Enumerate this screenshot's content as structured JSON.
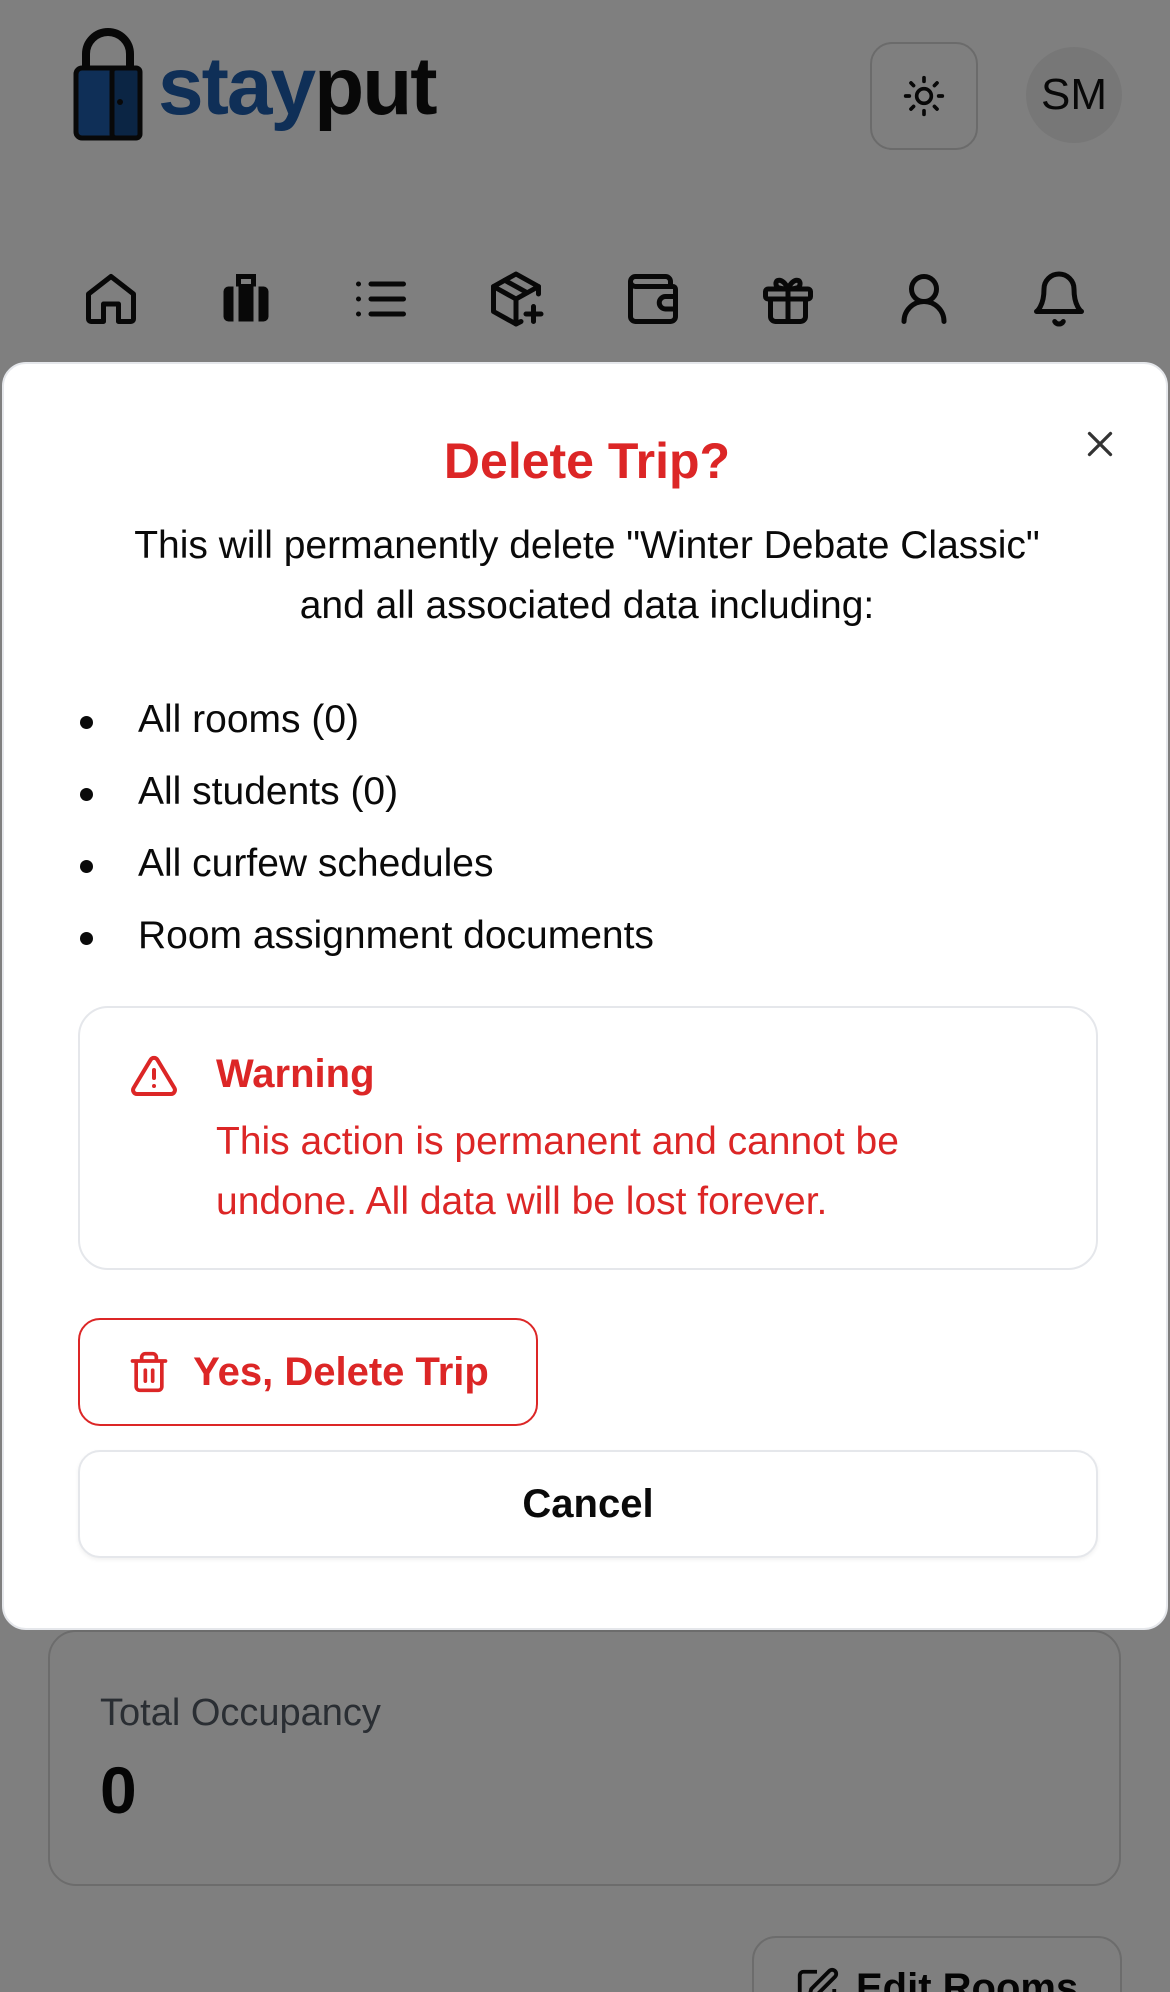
{
  "app": {
    "logo": {
      "part1": "stay",
      "part2": "put"
    },
    "avatar_initials": "SM",
    "theme_icon": "sun-icon",
    "nav_icons": [
      "home-icon",
      "luggage-icon",
      "list-icon",
      "package-plus-icon",
      "wallet-icon",
      "gift-icon",
      "user-icon",
      "bell-icon"
    ]
  },
  "background": {
    "card": {
      "label": "Total Occupancy",
      "value": "0"
    },
    "edit_button": {
      "label": "Edit Rooms"
    }
  },
  "modal": {
    "title": "Delete Trip?",
    "description": "This will permanently delete \"Winter Debate Classic\" and all associated data including:",
    "items": [
      "All rooms (0)",
      "All students (0)",
      "All curfew schedules",
      "Room assignment documents"
    ],
    "warning": {
      "title": "Warning",
      "text": "This action is permanent and cannot be undone. All data will be lost forever."
    },
    "delete_button": "Yes, Delete Trip",
    "cancel_button": "Cancel"
  },
  "colors": {
    "danger": "#dc2626",
    "brand_blue": "#1f5fae",
    "overlay": "rgba(0,0,0,0.5)"
  }
}
